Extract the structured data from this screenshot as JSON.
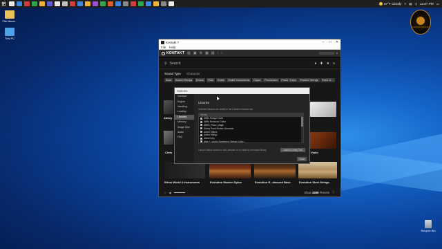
{
  "taskbar": {
    "icon_colors": [
      "#e8e8e8",
      "#3a86e0",
      "#d43c3c",
      "#2aa84a",
      "#f2b134",
      "#5a5adc",
      "#e8e8e8",
      "#c0c0c0",
      "#d43c3c",
      "#3a86e0",
      "#f2b134",
      "#9c4fd6",
      "#2aa84a",
      "#e05a2a",
      "#3a86e0",
      "#888888",
      "#d43c3c",
      "#2aa84a",
      "#3a86e0",
      "#f2b134",
      "#888888",
      "#e8e8e8"
    ],
    "weather": "87°F  Cloudy",
    "time": "12:07 PM"
  },
  "desktop": {
    "icons": [
      {
        "label": "File Mana...",
        "color": "#e8c15a",
        "icon": "folder-icon"
      },
      {
        "label": "This PC",
        "color": "#4ea3e8",
        "icon": "computer-icon"
      }
    ],
    "recycle_bin": "Recycle Bin",
    "badge_text": "MAKING SOUND"
  },
  "kontakt": {
    "title": "Kontakt 7",
    "menu": [
      "File",
      "Help"
    ],
    "logo": "KONTAKT",
    "search_placeholder": "Search",
    "filters": {
      "sound_type": "Sound Type",
      "character": "Character"
    },
    "chips": [
      "Bass",
      "Bowed Strings",
      "Drums",
      "Flute",
      "Guitar",
      "Mallet Instruments",
      "Organ",
      "Percussion",
      "Piano / Keys",
      "Plucked Strings",
      "Reed In..."
    ],
    "cards": [
      {
        "caption": "Abbey"
      },
      {
        "caption": "Chris"
      },
      {
        "caption": "Violin"
      },
      {
        "caption": "Ethno World 3 Instruments"
      },
      {
        "caption": "Evolution Modern Nylon"
      },
      {
        "caption": "Evolution R...dwound Bass"
      },
      {
        "caption": "Evolution Steel Strings"
      }
    ],
    "presets_count": "2459",
    "presets_label": "Presets",
    "presets_prefix": "Show"
  },
  "options_dialog": {
    "title": "Options",
    "sidebar": [
      "Interface",
      "Engine",
      "Handling",
      "Loading",
      "Libraries",
      "Memory",
      "Image Disk",
      "Audio",
      "FAQ"
    ],
    "selected_index": 4,
    "libraries_heading": "Libraries",
    "description": "Selected libraries are visible in the Libraries browser tab",
    "list_header": "Library",
    "libraries": [
      "ABBs Ratsgel Violin",
      "ABBs Redwood Guitar",
      "ABBS_Piano_Magik",
      "Abbey Road Modern Drummer",
      "Action Strikes",
      "Action Strings",
      "Alicia Keys",
      "Alba + London Symphonic Strings Collec..."
    ],
    "note": "Launch Native Access to add, activate or re-install a purchased library.",
    "launch_button": "Launch Library Tool",
    "close_button": "Close"
  }
}
